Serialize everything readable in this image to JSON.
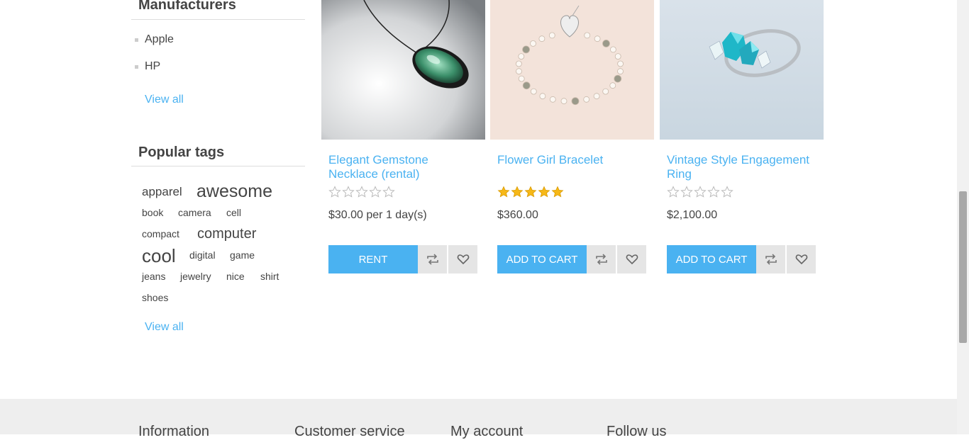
{
  "sidebar": {
    "manufacturers": {
      "title": "Manufacturers",
      "items": [
        {
          "label": "Apple"
        },
        {
          "label": "HP"
        }
      ],
      "view_all": "View all"
    },
    "popular_tags": {
      "title": "Popular tags",
      "tags": [
        {
          "label": "apparel"
        },
        {
          "label": "awesome"
        },
        {
          "label": "book"
        },
        {
          "label": "camera"
        },
        {
          "label": "cell"
        },
        {
          "label": "compact"
        },
        {
          "label": "computer"
        },
        {
          "label": "cool"
        },
        {
          "label": "digital"
        },
        {
          "label": "game"
        },
        {
          "label": "jeans"
        },
        {
          "label": "jewelry"
        },
        {
          "label": "nice"
        },
        {
          "label": "shirt"
        },
        {
          "label": "shoes"
        }
      ],
      "view_all": "View all"
    }
  },
  "products": [
    {
      "title": "Elegant Gemstone Necklace (rental)",
      "rating": 0,
      "price": "$30.00 per 1 day(s)",
      "button": "RENT",
      "image": "gemstone-necklace"
    },
    {
      "title": "Flower Girl Bracelet",
      "rating": 5,
      "price": "$360.00",
      "button": "ADD TO CART",
      "image": "pearl-bracelet"
    },
    {
      "title": "Vintage Style Engagement Ring",
      "rating": 0,
      "price": "$2,100.00",
      "button": "ADD TO CART",
      "image": "blue-stone-ring"
    }
  ],
  "footer": {
    "columns": [
      "Information",
      "Customer service",
      "My account",
      "Follow us"
    ]
  },
  "colors": {
    "accent": "#4ab2f1",
    "star_filled": "#f6b818",
    "star_empty": "#bbbbbb",
    "footer_bg": "#eeeeee"
  }
}
